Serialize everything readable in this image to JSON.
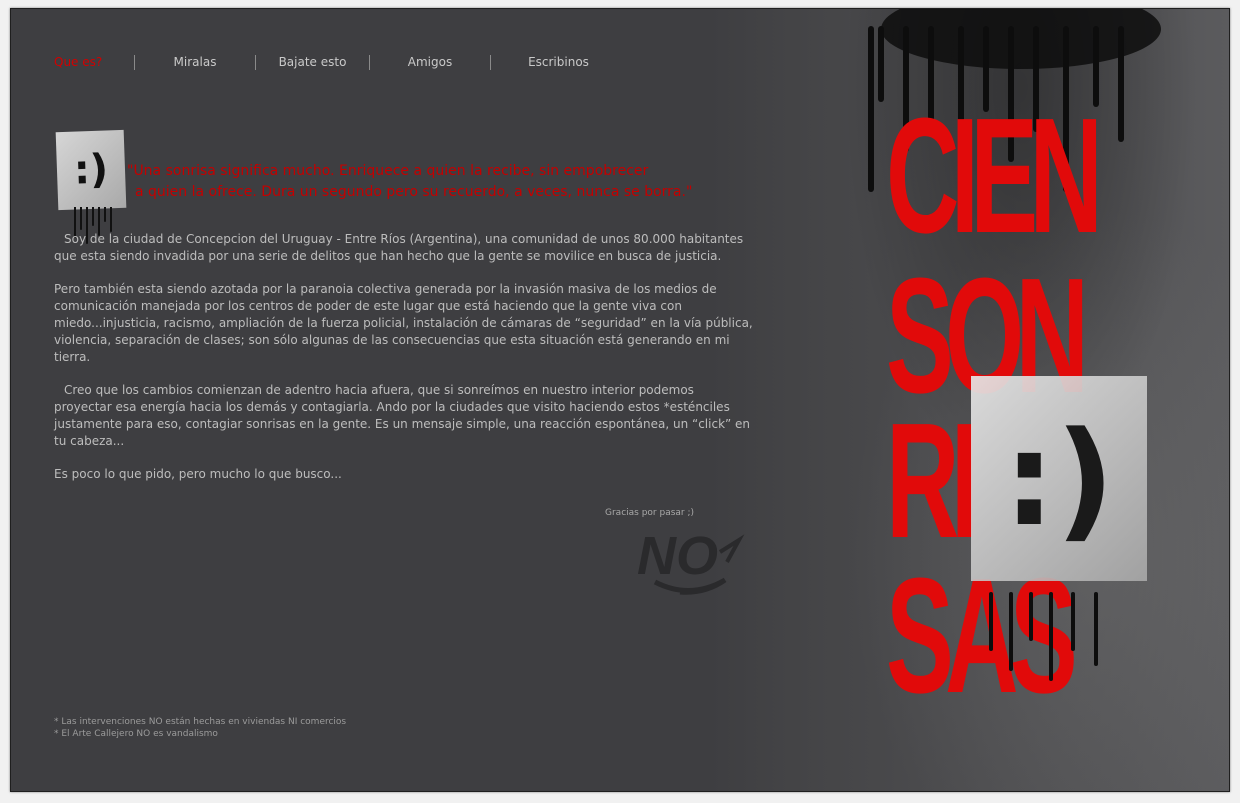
{
  "nav": {
    "items": [
      {
        "label": "Que es?",
        "active": true
      },
      {
        "label": "Miralas",
        "active": false
      },
      {
        "label": "Bajate esto",
        "active": false
      },
      {
        "label": "Amigos",
        "active": false
      },
      {
        "label": "Escribinos",
        "active": false
      }
    ]
  },
  "sticker": {
    "text": ":)"
  },
  "quote": {
    "line1": "\"Una sonrisa significa mucho. Enriquece a quien la recibe, sin empobrecer",
    "line2": "a quien la ofrece. Dura un segundo pero su recuerdo, a veces, nunca se borra.\""
  },
  "body": {
    "p1": "Soy de la ciudad de Concepcion del Uruguay - Entre Ríos (Argentina), una comunidad de unos 80.000 habitantes que esta siendo invadida por una serie de delitos que han hecho que la gente se movilice en busca de justicia.",
    "p2": "Pero también esta siendo azotada por la paranoia colectiva generada por la invasión masiva de los medios de comunicación manejada por los centros de poder de este lugar que está haciendo que la gente viva con miedo...injusticia, racismo, ampliación de la fuerza policial, instalación de cámaras de “seguridad” en la vía pública, violencia, separación de clases; son sólo algunas de las consecuencias que esta situación está generando en mi tierra.",
    "p3": "Creo que los cambios comienzan de adentro hacia afuera, que si sonreímos en nuestro interior podemos proyectar esa energía hacia los demás y contagiarla. Ando por la ciudades que visito haciendo estos *esténciles justamente para eso, contagiar sonrisas en la gente. Es un mensaje simple, una reacción espontánea, un “click” en tu cabeza...",
    "p4": "Es poco lo que pido, pero mucho lo que busco..."
  },
  "signature": {
    "thanks": "Gracias por pasar ;)",
    "tag": "NO"
  },
  "footnotes": {
    "n1": "* Las intervenciones NO están hechas en viviendas NI comercios",
    "n2": "* El Arte Callejero NO es vandalismo"
  },
  "poster": {
    "words": [
      "CIEN",
      "SON",
      "RI",
      "SAS"
    ],
    "smile": ":)",
    "red": "#e10a0a"
  }
}
